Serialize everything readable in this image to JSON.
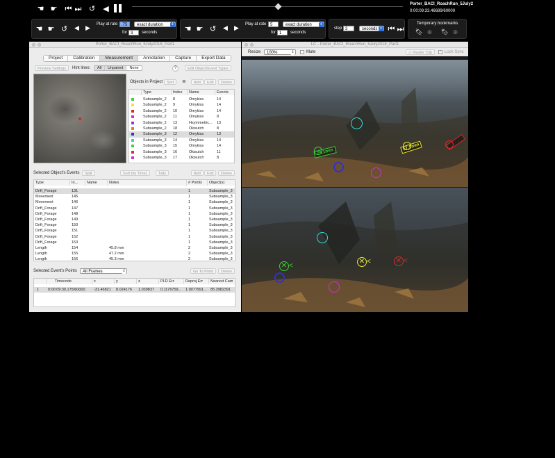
{
  "playback": {
    "file_name": "Porter_BACI_RoachRun_5July2",
    "timecode": "0:00:09:33.46689/60000",
    "left_group": {
      "play_at_rate_label": "Play at rate",
      "rate_value": ".75",
      "duration_mode": "exact duration",
      "for_label": "for",
      "for_value": "3",
      "seconds_label": "seconds"
    },
    "right_group": {
      "play_at_rate_label": "Play at rate",
      "rate_value": "5",
      "duration_mode": "exact duration",
      "for_label": "for",
      "for_value": "1",
      "seconds_label": "seconds"
    },
    "step": {
      "label": "step",
      "value": "3",
      "unit": "seconds"
    },
    "bookmarks": {
      "label": "Temporary bookmarks"
    }
  },
  "main_window": {
    "title": "Porter_BACI_RoachRun_5July2018_Part1",
    "tabs": [
      {
        "label": "Project",
        "active": false
      },
      {
        "label": "Calibration",
        "active": false
      },
      {
        "label": "Measurement",
        "active": true
      },
      {
        "label": "Annotation",
        "active": false
      },
      {
        "label": "Capture",
        "active": false
      },
      {
        "label": "Export Data",
        "active": false
      }
    ],
    "preview_settings": "Preview Settings",
    "hint_lines_label": "Hint lines:",
    "hint_options": [
      "All",
      "Unpaired",
      "None"
    ],
    "help": "?",
    "edit_object_event_types": "Edit Object/Event Types",
    "objects_label": "Objects in Project",
    "sort": "Sort",
    "add": "Add",
    "edit": "Edit",
    "delete": "Delete",
    "object_columns": [
      "Type",
      "Index",
      "Name",
      "Events"
    ],
    "objects": [
      {
        "type": "Subsample_2",
        "index": "8",
        "name": "Omykiss",
        "events": "14",
        "color": "#3ad43a"
      },
      {
        "type": "Subsample_2",
        "index": "9",
        "name": "Omykiss",
        "events": "14",
        "color": "#e8e830"
      },
      {
        "type": "Subsample_2",
        "index": "10",
        "name": "Omykiss",
        "events": "14",
        "color": "#e02828"
      },
      {
        "type": "Subsample_2",
        "index": "11",
        "name": "Omykiss",
        "events": "8",
        "color": "#d030d0"
      },
      {
        "type": "Subsample_2",
        "index": "13",
        "name": "Hsymmetric...",
        "events": "13",
        "color": "#9b30e0"
      },
      {
        "type": "Subsample_2",
        "index": "18",
        "name": "Okisutch",
        "events": "8",
        "color": "#e08020"
      },
      {
        "type": "Subsample_3",
        "index": "12",
        "name": "Omykiss",
        "events": "13",
        "color": "#3030d0"
      },
      {
        "type": "Subsample_3",
        "index": "14",
        "name": "Omykiss",
        "events": "14",
        "color": "#30d0d0"
      },
      {
        "type": "Subsample_3",
        "index": "15",
        "name": "Omykiss",
        "events": "14",
        "color": "#3ad43a"
      },
      {
        "type": "Subsample_3",
        "index": "16",
        "name": "Okisutch",
        "events": "11",
        "color": "#e02828"
      },
      {
        "type": "Subsample_3",
        "index": "17",
        "name": "Okisutch",
        "events": "8",
        "color": "#d030d0"
      }
    ],
    "selected_object_events": "Selected Object's Events",
    "split": "Split",
    "sort_by_time": "Sort (by Time)",
    "tally": "Tally",
    "event_columns": [
      "Type",
      "In...",
      "Name",
      "Notes",
      "# Points",
      "Object(s)"
    ],
    "events": [
      {
        "type": "Drift_Forage",
        "index": "131",
        "notes": "",
        "points": "1",
        "object": "Subsample_3"
      },
      {
        "type": "Movement",
        "index": "145",
        "notes": "",
        "points": "1",
        "object": "Subsample_3"
      },
      {
        "type": "Movement",
        "index": "146",
        "notes": "",
        "points": "1",
        "object": "Subsample_3"
      },
      {
        "type": "Drift_Forage",
        "index": "147",
        "notes": "",
        "points": "1",
        "object": "Subsample_3"
      },
      {
        "type": "Drift_Forage",
        "index": "148",
        "notes": "",
        "points": "1",
        "object": "Subsample_3"
      },
      {
        "type": "Drift_Forage",
        "index": "149",
        "notes": "",
        "points": "1",
        "object": "Subsample_3"
      },
      {
        "type": "Drift_Forage",
        "index": "150",
        "notes": "",
        "points": "1",
        "object": "Subsample_3"
      },
      {
        "type": "Drift_Forage",
        "index": "151",
        "notes": "",
        "points": "1",
        "object": "Subsample_3"
      },
      {
        "type": "Drift_Forage",
        "index": "152",
        "notes": "",
        "points": "1",
        "object": "Subsample_3"
      },
      {
        "type": "Drift_Forage",
        "index": "153",
        "notes": "",
        "points": "1",
        "object": "Subsample_3"
      },
      {
        "type": "Length",
        "index": "154",
        "notes": "45.8 mm",
        "points": "2",
        "object": "Subsample_3"
      },
      {
        "type": "Length",
        "index": "155",
        "notes": "47.2 mm",
        "points": "2",
        "object": "Subsample_3"
      },
      {
        "type": "Length",
        "index": "156",
        "notes": "45.3 mm",
        "points": "2",
        "object": "Subsample_3"
      }
    ],
    "selected_event_points": "Selected Event's Points",
    "frames_filter": "All Frames",
    "go_to_point": "Go To Point",
    "point_columns": [
      "Timecode",
      "x",
      "y",
      "z",
      "PLD Err",
      "Reproj Err",
      "Nearest Cam"
    ],
    "points": [
      {
        "n": "1",
        "timecode": "0:00:09:30.175/60000",
        "x": "-31.46821",
        "y": "8.024176",
        "z": "1.039837",
        "pld": "0.1176759...",
        "reproj": "1.0077991...",
        "nearest": "85.3982391"
      }
    ]
  },
  "video_window": {
    "title": "LC - Porter_BACI_RoachRun_5July2018_Part1",
    "resize_label": "Resize",
    "zoom": "100%",
    "mute": "Mute",
    "master_clip": "Master Clip",
    "lock_sync": "Lock Sync",
    "length_labels": [
      "79.1mm",
      "57.9mm"
    ]
  },
  "colors": {
    "accent": "#2d6ee0",
    "cyan": "#30e0e0",
    "green": "#3ad43a",
    "yellow": "#e8e830",
    "red": "#e02828",
    "magenta": "#d030d0",
    "blue": "#3030d0"
  }
}
